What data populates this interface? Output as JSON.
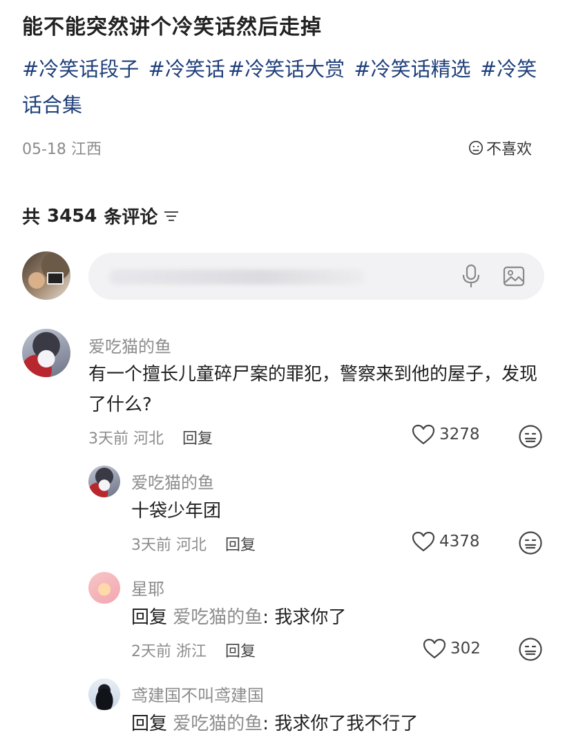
{
  "post": {
    "title": "能不能突然讲个冷笑话然后走掉",
    "tags": [
      "#冷笑话段子",
      "#冷笑话",
      "#冷笑话大赏",
      "#冷笑话精选",
      "#冷笑话合集"
    ],
    "date": "05-18",
    "location": "江西",
    "dislike_label": "不喜欢"
  },
  "comments_header": {
    "prefix": "共",
    "count": "3454",
    "suffix": "条评论"
  },
  "composer": {
    "placeholder": "",
    "mic_icon": "microphone-icon",
    "image_icon": "image-icon"
  },
  "comments": [
    {
      "user": "爱吃猫的鱼",
      "text": "有一个擅长儿童碎尸案的罪犯，警察来到他的屋子，发现了什么?",
      "time": "3天前",
      "location": "河北",
      "reply_label": "回复",
      "likes": "3278"
    },
    {
      "user": "爱吃猫的鱼",
      "text": "十袋少年团",
      "time": "3天前",
      "location": "河北",
      "reply_label": "回复",
      "likes": "4378"
    },
    {
      "user": "星耶",
      "reply_prefix": "回复",
      "reply_to": "爱吃猫的鱼",
      "text": ": 我求你了",
      "time": "2天前",
      "location": "浙江",
      "reply_label": "回复",
      "likes": "302"
    },
    {
      "user": "鸢建国不叫鸢建国",
      "reply_prefix": "回复",
      "reply_to": "爱吃猫的鱼",
      "text": ": 我求你了我不行了"
    }
  ]
}
